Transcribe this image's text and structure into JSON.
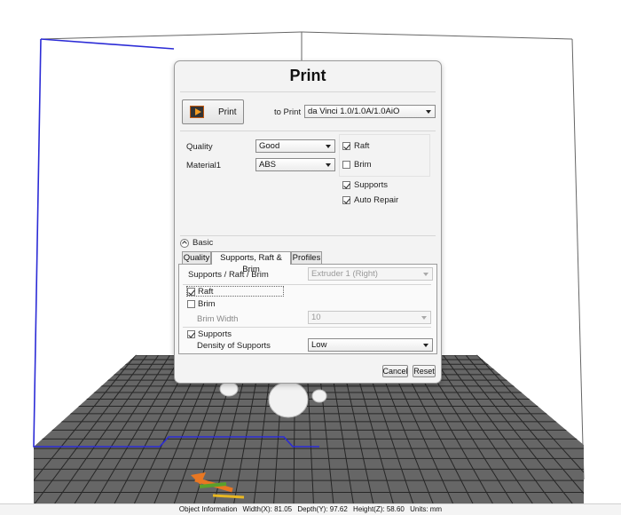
{
  "dialog": {
    "title": "Print",
    "print_button_label": "Print",
    "to_print_label": "to Print",
    "printer_selected": "da Vinci 1.0/1.0A/1.0AiO",
    "quality_label": "Quality",
    "quality_selected": "Good",
    "material_label": "Material1",
    "material_selected": "ABS",
    "raft_label": "Raft",
    "raft_checked": true,
    "brim_label": "Brim",
    "brim_checked": false,
    "supports_label": "Supports",
    "supports_checked": true,
    "auto_repair_label": "Auto Repair",
    "auto_repair_checked": true,
    "basic_label": "Basic"
  },
  "tabs": [
    {
      "label": "Quality",
      "active": false
    },
    {
      "label": "Supports, Raft & Brim",
      "active": true
    },
    {
      "label": "Profiles",
      "active": false
    }
  ],
  "panel": {
    "supports_raft_brim_label": "Supports / Raft / Brim",
    "extruder_selected": "Extruder 1 (Right)",
    "raft_label": "Raft",
    "raft_checked": true,
    "brim_label": "Brim",
    "brim_checked": false,
    "brim_width_label": "Brim Width",
    "brim_width_value": "10",
    "supports_label": "Supports",
    "supports_checked": true,
    "density_label": "Density of Supports",
    "density_selected": "Low"
  },
  "buttons": {
    "cancel": "Cancel",
    "reset": "Reset"
  },
  "status_bar": {
    "object_information": "Object Information",
    "width": "Width(X): 81.05",
    "depth": "Depth(Y): 97.62",
    "height": "Height(Z): 58.60",
    "units": "Units: mm"
  },
  "colors": {
    "build_frame": "#555555",
    "front_frame": "#2b2bd6",
    "grid_fill": "#666666",
    "grid_line": "#2a2a2a",
    "accent": "#f29b22"
  }
}
